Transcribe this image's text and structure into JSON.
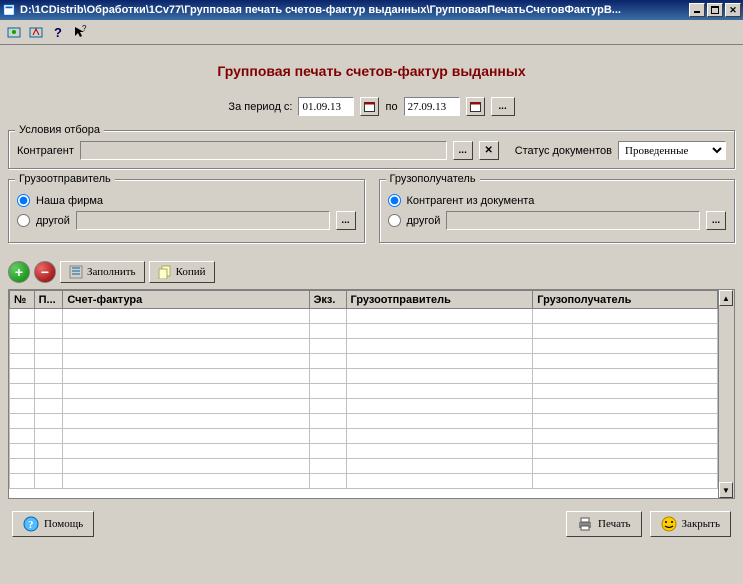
{
  "window": {
    "title": "D:\\1CDistrib\\Обработки\\1Cv77\\Групповая печать счетов-фактур выданных\\ГрупповаяПечатьСчетовФактурВ..."
  },
  "heading": "Групповая печать счетов-фактур выданных",
  "period": {
    "label_from": "За период с:",
    "date_from": "01.09.13",
    "label_to": "по",
    "date_to": "27.09.13"
  },
  "filter": {
    "group_title": "Условия отбора",
    "contractor_label": "Контрагент",
    "contractor_value": "",
    "status_label": "Статус документов",
    "status_value": "Проведенные"
  },
  "consignor": {
    "group_title": "Грузоотправитель",
    "opt_our": "Наша фирма",
    "opt_other": "другой",
    "other_value": ""
  },
  "consignee": {
    "group_title": "Грузополучатель",
    "opt_from_doc": "Контрагент из документа",
    "opt_other": "другой",
    "other_value": ""
  },
  "actions": {
    "fill": "Заполнить",
    "copies": "Копий"
  },
  "table": {
    "columns": [
      "№",
      "П...",
      "Счет-фактура",
      "Экз.",
      "Грузоотправитель",
      "Грузополучатель"
    ],
    "rows": []
  },
  "footer": {
    "help": "Помощь",
    "print": "Печать",
    "close": "Закрыть"
  }
}
